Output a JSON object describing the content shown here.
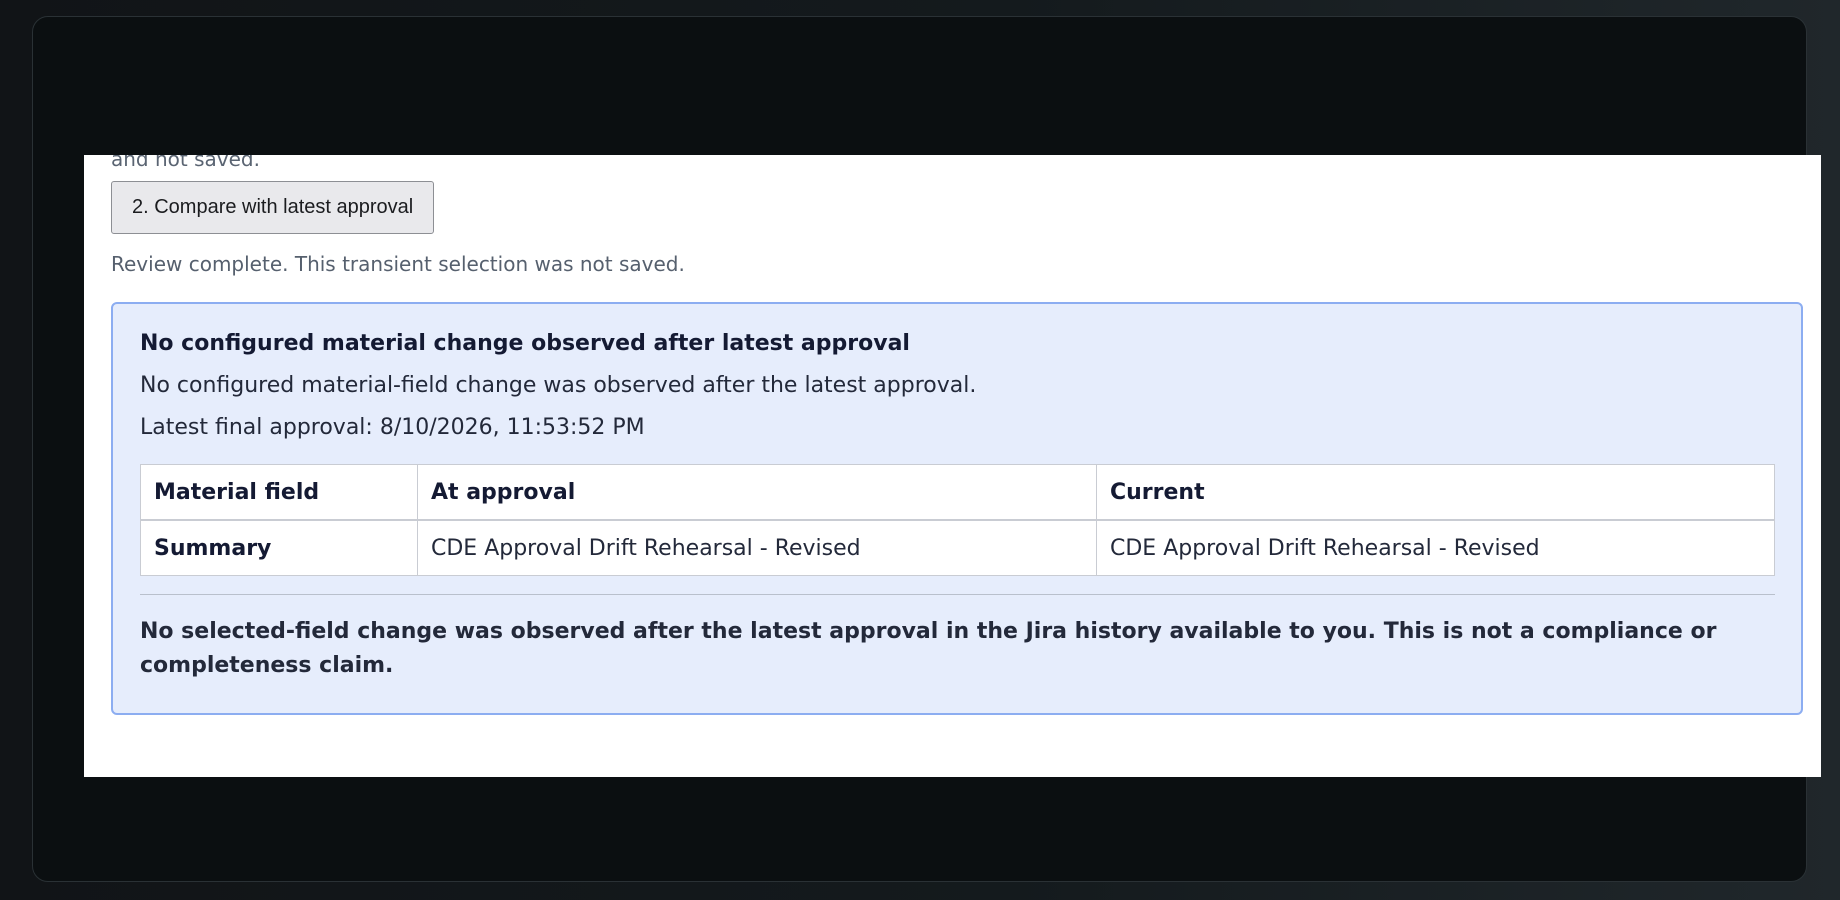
{
  "panel": {
    "cut_text": "and not saved.",
    "compare_button_label": "2. Compare with latest approval",
    "status_text": "Review complete. This transient selection was not saved."
  },
  "result": {
    "title": "No configured material change observed after latest approval",
    "description": "No configured material-field change was observed after the latest approval.",
    "latest_approval": "Latest final approval: 8/10/2026, 11:53:52 PM",
    "table": {
      "headers": [
        "Material field",
        "At approval",
        "Current"
      ],
      "rows": [
        [
          "Summary",
          "CDE Approval Drift Rehearsal - Revised",
          "CDE Approval Drift Rehearsal - Revised"
        ]
      ]
    },
    "disclaimer": "No selected-field change was observed after the latest approval in the Jira history available to you. This is not a compliance or completeness claim."
  },
  "colors": {
    "result_background": "#e6edfc",
    "result_border": "#8cadf1",
    "frame_background": "#0b0f11"
  }
}
